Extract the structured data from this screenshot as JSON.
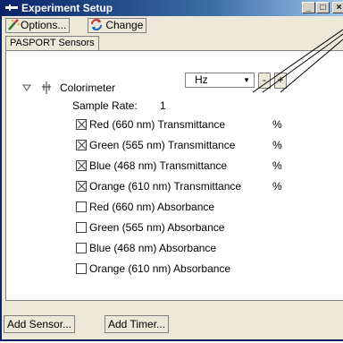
{
  "window": {
    "title": "Experiment Setup"
  },
  "titlebar_buttons": {
    "minimize": "_",
    "maximize": "□",
    "close": "×"
  },
  "toolbar": {
    "options_label": "Options...",
    "change_label": "Change"
  },
  "tab": {
    "label": "PASPORT Sensors"
  },
  "tree": {
    "sensor_label": "Colorimeter",
    "rate_label": "Sample Rate:",
    "rate_value": "1",
    "rate_unit": "Hz",
    "minus_label": "-",
    "plus_label": "+",
    "measurements": [
      {
        "label": "Red (660 nm) Transmittance",
        "checked": true,
        "unit": "%"
      },
      {
        "label": "Green (565 nm) Transmittance",
        "checked": true,
        "unit": "%"
      },
      {
        "label": "Blue (468 nm) Transmittance",
        "checked": true,
        "unit": "%"
      },
      {
        "label": "Orange (610 nm) Transmittance",
        "checked": true,
        "unit": "%"
      },
      {
        "label": "Red (660 nm) Absorbance",
        "checked": false,
        "unit": ""
      },
      {
        "label": "Green (565 nm) Absorbance",
        "checked": false,
        "unit": ""
      },
      {
        "label": "Blue (468 nm) Absorbance",
        "checked": false,
        "unit": ""
      },
      {
        "label": "Orange (610 nm) Absorbance",
        "checked": false,
        "unit": ""
      }
    ]
  },
  "footer": {
    "add_sensor_label": "Add Sensor...",
    "add_timer_label": "Add Timer..."
  },
  "icons": {
    "expand": "triangle-down-icon",
    "sensor": "sensor-probe-icon",
    "options": "options-wand-icon",
    "change": "change-arrows-icon"
  },
  "colors": {
    "titlebar": "#0a246a",
    "window": "#ece9d8",
    "panel": "#ffffff"
  }
}
